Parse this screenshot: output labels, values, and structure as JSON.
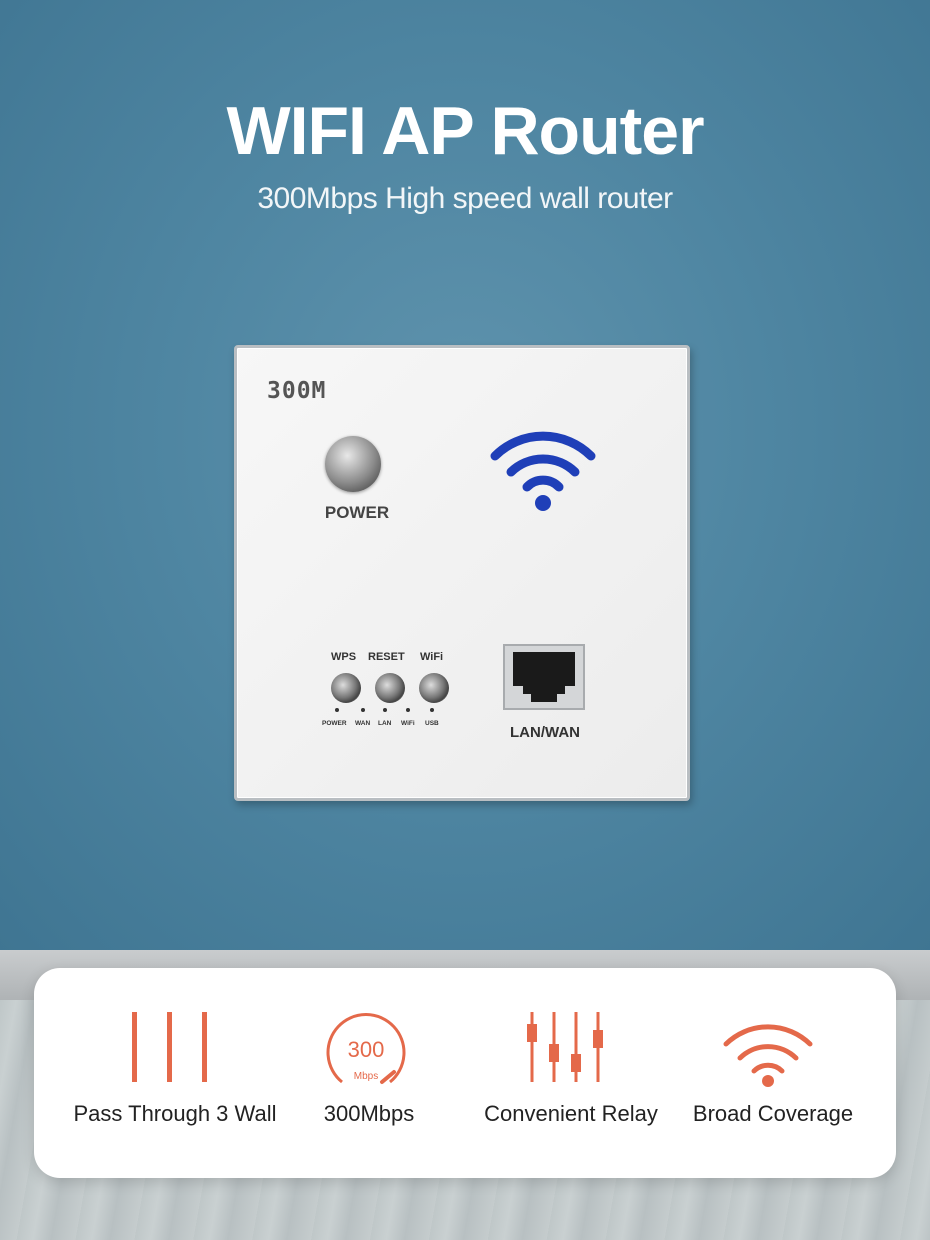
{
  "header": {
    "title": "WIFI AP Router",
    "subtitle": "300Mbps High speed wall router"
  },
  "device": {
    "model_text": "300M",
    "power_label": "POWER",
    "buttons": [
      "WPS",
      "RESET",
      "WiFi"
    ],
    "leds": [
      "POWER",
      "WAN",
      "LAN",
      "WiFi",
      "USB"
    ],
    "port_label": "LAN/WAN"
  },
  "features": [
    {
      "label": "Pass Through 3 Wall",
      "icon": "walls-icon"
    },
    {
      "label": "300Mbps",
      "icon": "speedometer-icon",
      "gauge_value": "300",
      "gauge_unit": "Mbps"
    },
    {
      "label": "Convenient Relay",
      "icon": "sliders-icon"
    },
    {
      "label": "Broad Coverage",
      "icon": "wifi-icon"
    }
  ],
  "colors": {
    "wall": "#4f86a2",
    "accent": "#e4694a",
    "wifi_logo": "#1f3fb8"
  }
}
